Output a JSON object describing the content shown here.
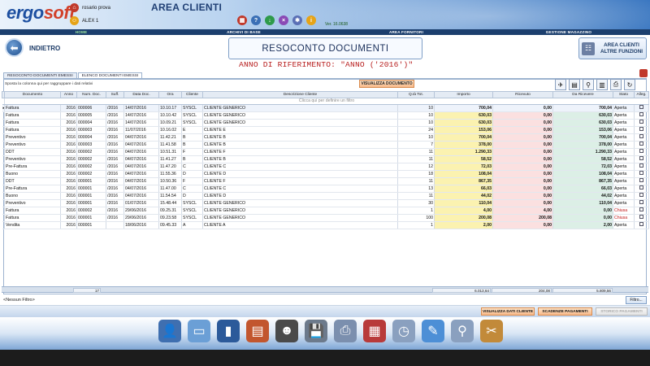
{
  "app": {
    "logo_main": "ergo",
    "logo_accent": "soft",
    "area_title": "AREA CLIENTI",
    "version": "Ver. 16.0638"
  },
  "users": [
    {
      "name": "rosario prova"
    },
    {
      "name": "ALEX 1"
    }
  ],
  "nav": [
    "HOME",
    "ARCHIVI DI BASE",
    "AREA FORNITORI",
    "GESTIONE MAGAZZINO"
  ],
  "header": {
    "back_label": "INDIETRO",
    "page_title": "RESOCONTO DOCUMENTI",
    "more_line1": "AREA CLIENTI",
    "more_line2": "ALTRE FUNZIONI",
    "year_label": "ANNO DI RIFERIMENTO: \"ANNO ('2016')\""
  },
  "tabs": [
    "RESOCONTO DOCUMENTI EMESSI",
    "ELENCO DOCUMENTI EMESSI"
  ],
  "toolbar": {
    "group_hint": "Sposta la colonna qui per raggruppare i dati relativi",
    "view_document": "VISUALIZZA DOCUMENTO"
  },
  "table": {
    "columns": [
      "Documento",
      "Anno",
      "Num. Doc.",
      "Suff.",
      "Data Doc.",
      "Ora",
      "Cliente",
      "Descrizione Cliente",
      "Q.tà Tot.",
      "Importo",
      "Ricevuto",
      "Da Ricevere",
      "Stato",
      "Alleg."
    ],
    "filter_hint": "Clicca qui per definire un filtro",
    "rows": [
      [
        "Fattura",
        "2016",
        "000006",
        "/2016",
        "14/07/2016",
        "10.10.17",
        "SYSCL",
        "CLIENTE GENERICO",
        "10",
        "700,04",
        "0,00",
        "700,04",
        "Aperta"
      ],
      [
        "Fattura",
        "2016",
        "000005",
        "/2016",
        "14/07/2016",
        "10.10.42",
        "SYSCL",
        "CLIENTE GENERICO",
        "10",
        "630,03",
        "0,00",
        "630,03",
        "Aperta"
      ],
      [
        "Fattura",
        "2016",
        "000004",
        "/2016",
        "14/07/2016",
        "10.09.21",
        "SYSCL",
        "CLIENTE GENERICO",
        "10",
        "630,03",
        "0,00",
        "630,03",
        "Aperta"
      ],
      [
        "Fattura",
        "2016",
        "000003",
        "/2016",
        "11/07/2016",
        "10.16.02",
        "E",
        "CLIENTE E",
        "24",
        "153,06",
        "0,00",
        "153,06",
        "Aperta"
      ],
      [
        "Preventivo",
        "2016",
        "000004",
        "/2016",
        "04/07/2016",
        "11.42.21",
        "B",
        "CLIENTE B",
        "10",
        "700,04",
        "0,00",
        "700,04",
        "Aperta"
      ],
      [
        "Preventivo",
        "2016",
        "000003",
        "/2016",
        "04/07/2016",
        "11.41.58",
        "B",
        "CLIENTE B",
        "7",
        "378,00",
        "0,00",
        "378,00",
        "Aperta"
      ],
      [
        "DDT",
        "2016",
        "000002",
        "/2016",
        "04/07/2016",
        "10.51.31",
        "F",
        "CLIENTE F",
        "11",
        "1.290,33",
        "0,00",
        "1.290,33",
        "Aperta"
      ],
      [
        "Preventivo",
        "2016",
        "000002",
        "/2016",
        "04/07/2016",
        "11.41.27",
        "B",
        "CLIENTE B",
        "11",
        "58,52",
        "0,00",
        "58,52",
        "Aperta"
      ],
      [
        "Pre-Fattura",
        "2016",
        "000002",
        "/2016",
        "04/07/2016",
        "11.47.20",
        "C",
        "CLIENTE C",
        "12",
        "72,03",
        "0,00",
        "72,03",
        "Aperta"
      ],
      [
        "Buono",
        "2016",
        "000002",
        "/2016",
        "04/07/2016",
        "11.55.36",
        "D",
        "CLIENTE D",
        "18",
        "108,04",
        "0,00",
        "108,04",
        "Aperta"
      ],
      [
        "DDT",
        "2016",
        "000001",
        "/2016",
        "04/07/2016",
        "10.50.36",
        "F",
        "CLIENTE F",
        "11",
        "867,35",
        "0,00",
        "867,35",
        "Aperta"
      ],
      [
        "Pre-Fattura",
        "2016",
        "000001",
        "/2016",
        "04/07/2016",
        "11.47.00",
        "C",
        "CLIENTE C",
        "13",
        "66,03",
        "0,00",
        "66,03",
        "Aperta"
      ],
      [
        "Buono",
        "2016",
        "000001",
        "/2016",
        "04/07/2016",
        "11.54.54",
        "D",
        "CLIENTE D",
        "11",
        "44,02",
        "0,00",
        "44,02",
        "Aperta"
      ],
      [
        "Preventivo",
        "2016",
        "000001",
        "/2016",
        "01/07/2016",
        "15.48.44",
        "SYSCL",
        "CLIENTE GENERICO",
        "30",
        "110,04",
        "0,00",
        "110,04",
        "Aperta"
      ],
      [
        "Fattura",
        "2016",
        "000002",
        "/2016",
        "29/06/2016",
        "09.25.31",
        "SYSCL",
        "CLIENTE GENERICO",
        "1",
        "4,00",
        "4,00",
        "0,00",
        "Chiusa"
      ],
      [
        "Fattura",
        "2016",
        "000001",
        "/2016",
        "29/06/2016",
        "09.23.58",
        "SYSCL",
        "CLIENTE GENERICO",
        "100",
        "200,08",
        "200,08",
        "0,00",
        "Chiusa"
      ],
      [
        "Vendita",
        "2016",
        "000001",
        "",
        "18/06/2016",
        "09.45.33",
        "A",
        "CLIENTE A",
        "1",
        "2,00",
        "0,00",
        "2,00",
        "Aperta"
      ]
    ]
  },
  "totals": {
    "count": "17",
    "importo": "6.013,64",
    "ricevuto": "204,08",
    "da_ricevere": "5.809,56"
  },
  "bottom": {
    "no_filter": "<Nessun Filtro>",
    "filter_button": "Filtro...",
    "show_client": "VISUALIZZA DATI CLIENTE",
    "due_payments": "SCADENZE PAGAMENTI",
    "history_payments": "STORICO PAGAMENTI"
  },
  "colors": {
    "header_dark": "#1c3f6e",
    "accent_orange": "#f7b98a",
    "importo_bg": "#fbf2b0",
    "ricevuto_bg": "#fbe0e0",
    "da_ricevere_bg": "#dcefe6",
    "chiusa_red": "#c01818"
  }
}
